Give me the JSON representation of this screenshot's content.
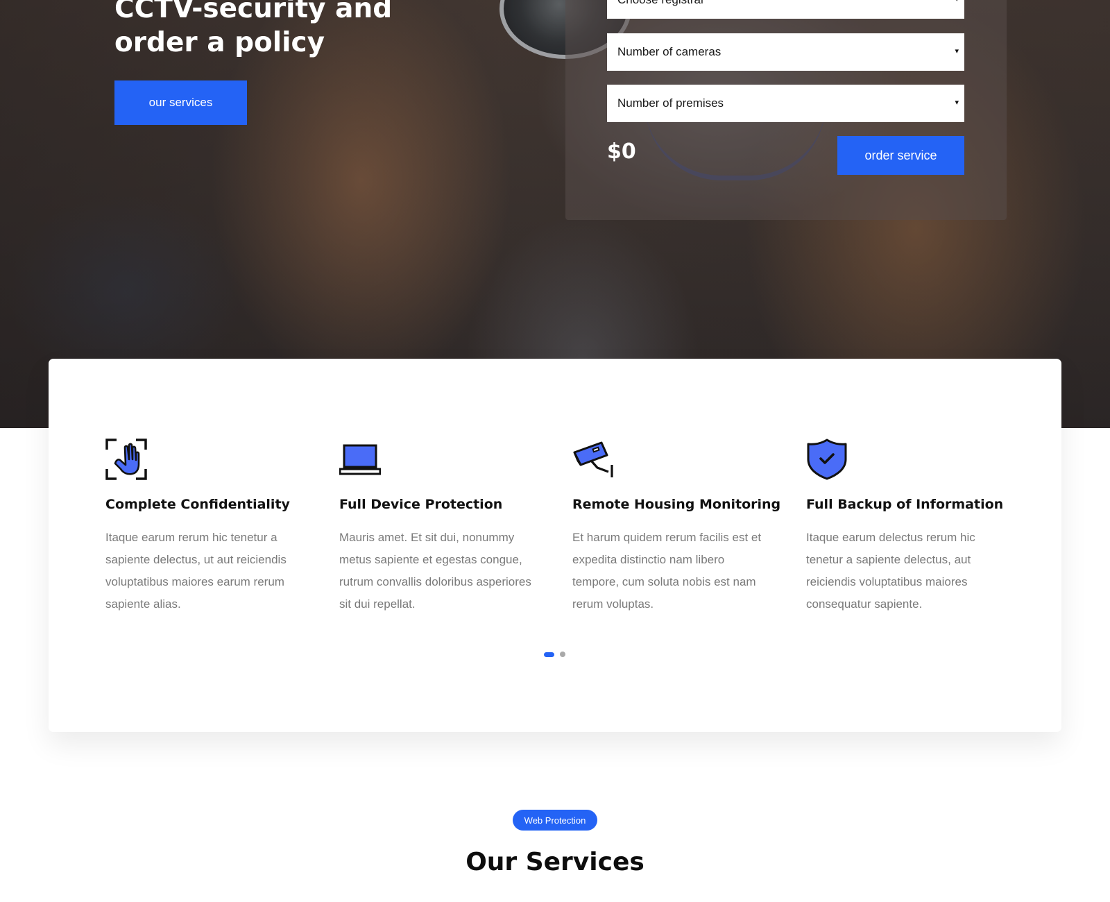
{
  "hero": {
    "title_line1": "CCTV-security and",
    "title_line2": "order a policy",
    "services_button": "our services"
  },
  "order_form": {
    "registrar_select": "Choose registrar",
    "cameras_select": "Number of cameras",
    "premises_select": "Number of premises",
    "price": "$0",
    "order_button": "order service",
    "arrow": "▾"
  },
  "features": [
    {
      "icon": "hand-scan-icon",
      "title": "Complete Confidentiality",
      "text": "Itaque earum rerum hic tenetur a sapiente delectus, ut aut reiciendis voluptatibus maiores earum rerum sapiente alias."
    },
    {
      "icon": "laptop-icon",
      "title": "Full Device Protection",
      "text": "Mauris amet. Et sit dui, nonummy metus sapiente et egestas congue, rutrum convallis doloribus asperiores sit dui repellat."
    },
    {
      "icon": "security-camera-icon",
      "title": "Remote Housing Monitoring",
      "text": "Et harum quidem rerum facilis est et expedita distinctio nam libero tempore, cum soluta nobis est nam rerum voluptas."
    },
    {
      "icon": "shield-check-icon",
      "title": "Full Backup of Information",
      "text": "Itaque earum delectus rerum hic tenetur a sapiente delectus, aut reiciendis voluptatibus maiores consequatur sapiente."
    }
  ],
  "carousel": {
    "active_index": 0,
    "count": 2
  },
  "services_section": {
    "tag": "Web Protection",
    "title": "Our Services"
  },
  "colors": {
    "accent": "#2463f5",
    "icon_fill": "#4a6cf7",
    "heading": "#111111",
    "body_text": "#7a7a7a"
  }
}
